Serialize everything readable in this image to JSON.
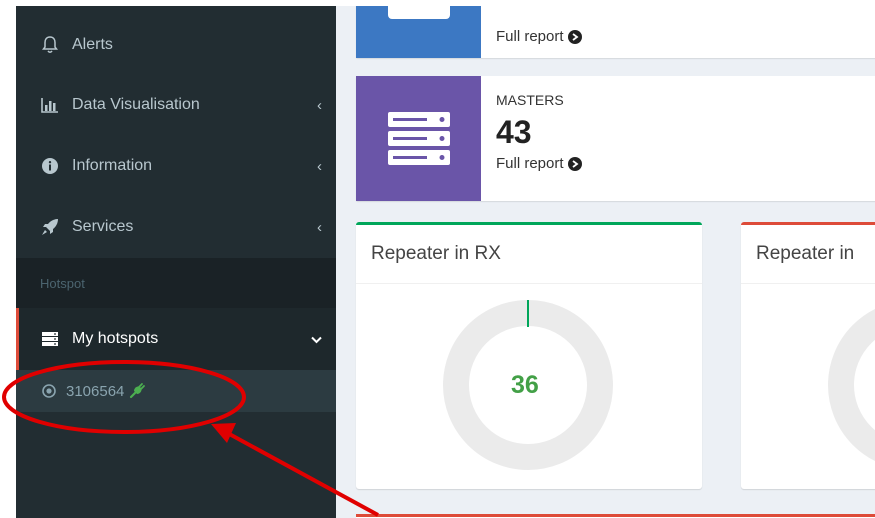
{
  "sidebar": {
    "items": [
      {
        "label": "Alerts",
        "icon": "bell-icon"
      },
      {
        "label": "Data Visualisation",
        "icon": "bar-chart-icon"
      },
      {
        "label": "Information",
        "icon": "info-circle-icon"
      },
      {
        "label": "Services",
        "icon": "rocket-icon"
      }
    ],
    "section_header": "Hotspot",
    "active_item": {
      "label": "My hotspots",
      "icon": "server-icon"
    },
    "sub_item": {
      "label": "3106564",
      "icon": "radio-button-icon",
      "status_icon": "plug-icon",
      "status_color": "#4caf50"
    }
  },
  "infoboxes": [
    {
      "label": "",
      "value": "",
      "link": "Full report",
      "color": "#3c78c3"
    },
    {
      "label": "MASTERS",
      "value": "43",
      "link": "Full report",
      "color": "#6a55a8"
    }
  ],
  "boxes": [
    {
      "title": "Repeater in RX",
      "value": "36",
      "accent": "#00a65a"
    },
    {
      "title": "Repeater in",
      "value": "",
      "accent": "#dd4b39"
    }
  ],
  "annotation": {
    "color": "#e00000"
  }
}
